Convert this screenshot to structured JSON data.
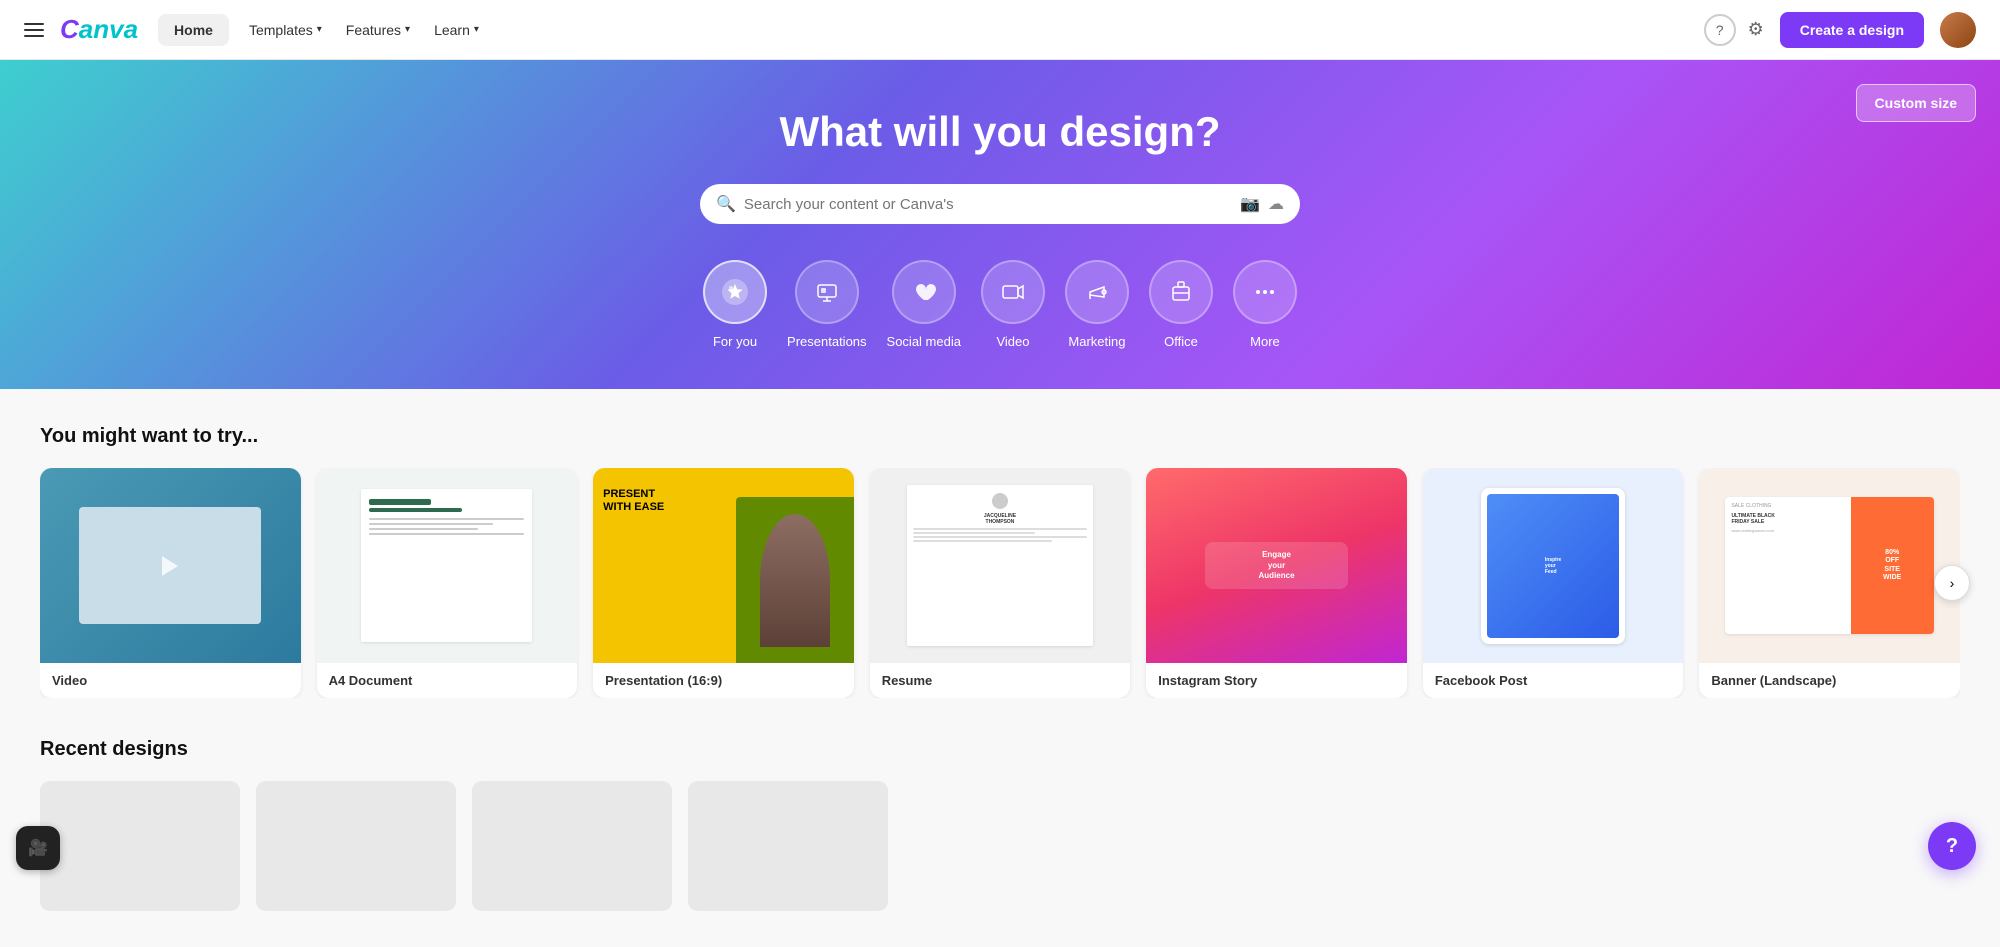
{
  "navbar": {
    "logo": "Canva",
    "home_label": "Home",
    "templates_label": "Templates",
    "features_label": "Features",
    "learn_label": "Learn",
    "cta_label": "Create a design"
  },
  "hero": {
    "title": "What will you design?",
    "custom_size_label": "Custom size",
    "search_placeholder": "Search your content or Canva's"
  },
  "categories": [
    {
      "id": "for-you",
      "label": "For you",
      "icon": "✦",
      "active": true
    },
    {
      "id": "presentations",
      "label": "Presentations",
      "icon": "📊",
      "active": false
    },
    {
      "id": "social-media",
      "label": "Social media",
      "icon": "♥",
      "active": false
    },
    {
      "id": "video",
      "label": "Video",
      "icon": "▶",
      "active": false
    },
    {
      "id": "marketing",
      "label": "Marketing",
      "icon": "📣",
      "active": false
    },
    {
      "id": "office",
      "label": "Office",
      "icon": "💼",
      "active": false
    },
    {
      "id": "more",
      "label": "More",
      "icon": "•••",
      "active": false
    }
  ],
  "try_section": {
    "title": "You might want to try...",
    "cards": [
      {
        "id": "video",
        "label": "Video",
        "thumb_type": "video"
      },
      {
        "id": "a4-doc",
        "label": "A4 Document",
        "thumb_type": "doc"
      },
      {
        "id": "presentation",
        "label": "Presentation (16:9)",
        "thumb_type": "pres"
      },
      {
        "id": "resume",
        "label": "Resume",
        "thumb_type": "resume"
      },
      {
        "id": "instagram-story",
        "label": "Instagram Story",
        "thumb_type": "insta"
      },
      {
        "id": "facebook-post",
        "label": "Facebook Post",
        "thumb_type": "fb"
      },
      {
        "id": "banner",
        "label": "Banner (Landscape)",
        "thumb_type": "banner"
      }
    ]
  },
  "recent_section": {
    "title": "Recent designs"
  },
  "help": {
    "label": "?"
  },
  "video_rec": {
    "label": "🎥"
  }
}
